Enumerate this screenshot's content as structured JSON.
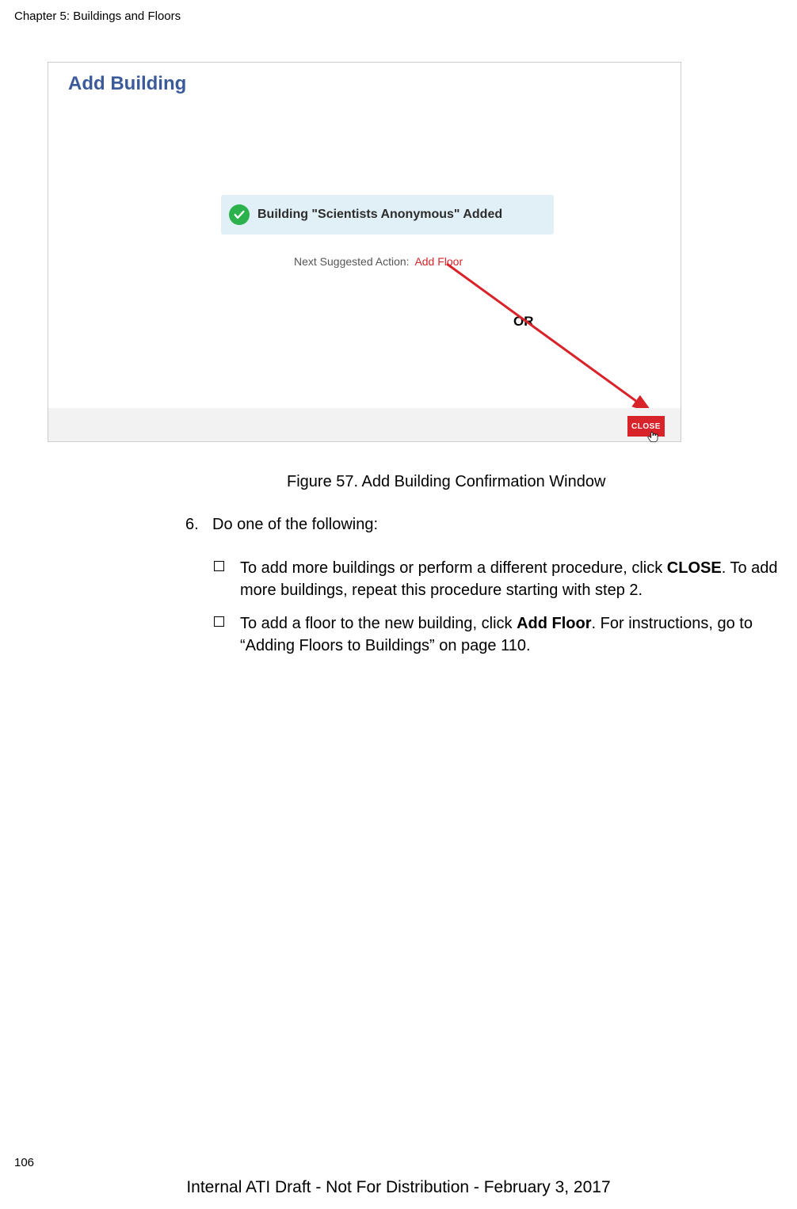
{
  "chapter_header": "Chapter 5: Buildings and Floors",
  "figure": {
    "window_title": "Add Building",
    "confirmation_message": "Building \"Scientists Anonymous\" Added",
    "next_action_label": "Next Suggested Action:",
    "next_action_link": "Add Floor",
    "or_label": "OR",
    "close_button": "CLOSE"
  },
  "figure_caption": "Figure 57. Add Building Confirmation Window",
  "step": {
    "number": "6.",
    "text": "Do one of the following:"
  },
  "bullets": [
    {
      "pre": "To add more buildings or perform a different procedure, click ",
      "bold": "CLOSE",
      "post": ". To add more buildings, repeat this procedure starting with step 2."
    },
    {
      "pre": "To add a floor to the new building, click ",
      "bold": "Add Floor",
      "post": ". For instructions, go to “Adding Floors to Buildings” on page 110."
    }
  ],
  "page_number": "106",
  "footer": "Internal ATI Draft - Not For Distribution - February 3, 2017"
}
